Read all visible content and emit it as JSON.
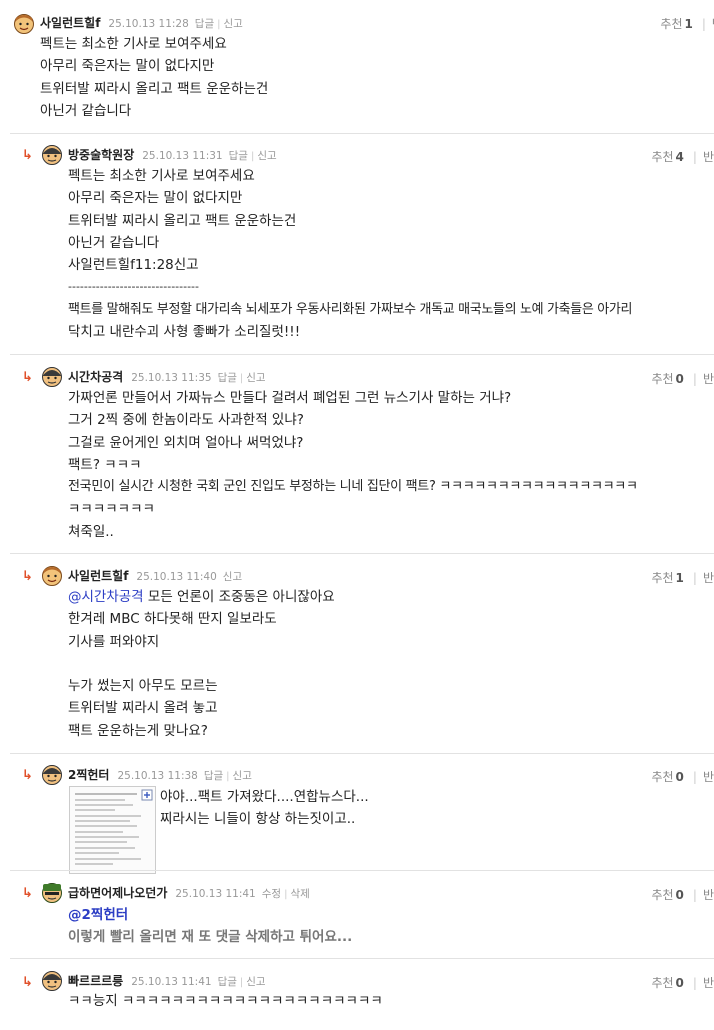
{
  "comments": [
    {
      "nick": "사일런트힐f",
      "date": "25.10.13 11:28",
      "actions": [
        "답글",
        "신고"
      ],
      "rec_label": "추천",
      "rec_count": "1",
      "opp_label": "반대",
      "lines": [
        "펙트는 최소한 기사로 보여주세요",
        "아무리 죽은자는 말이 없다지만",
        "트위터발 찌라시 올리고 팩트 운운하는건",
        "아닌거 같습니다"
      ]
    },
    {
      "nick": "방중술학원장",
      "date": "25.10.13 11:31",
      "actions": [
        "답글",
        "신고"
      ],
      "rec_label": "추천",
      "rec_count": "4",
      "opp_label": "반",
      "lines": [
        "펙트는 최소한 기사로 보여주세요",
        "아무리 죽은자는 말이 없다지만",
        "트위터발 찌라시 올리고 팩트 운운하는건",
        "아닌거 같습니다",
        "사일런트힐f11:28신고",
        "---------------------------------",
        "팩트를 말해줘도 부정할 대가리속 뇌세포가 우동사리화된 가짜보수 개독교 매국노들의 노예 가축들은 아가리",
        "닥치고 내란수괴 사형 좋빠가 소리질럿!!!"
      ]
    },
    {
      "nick": "시간차공격",
      "date": "25.10.13 11:35",
      "actions": [
        "답글",
        "신고"
      ],
      "rec_label": "추천",
      "rec_count": "0",
      "opp_label": "반",
      "lines": [
        "가짜언론 만들어서 가짜뉴스 만들다 걸려서 폐업된 그런 뉴스기사 말하는 거냐?",
        "그거 2찍 중에 한놈이라도 사과한적 있냐?",
        "그걸로 윤어게인 외치며 얼아나 써먹었냐?",
        "팩트? ㅋㅋㅋ",
        "전국민이 실시간 시청한 국회 군인 진입도 부정하는 니네 집단이 팩트? ㅋㅋㅋㅋㅋㅋㅋㅋㅋㅋㅋㅋㅋㅋㅋㅋㅋ",
        "ㅋㅋㅋㅋㅋㅋㅋ",
        "쳐죽일.."
      ]
    },
    {
      "nick": "사일런트힐f",
      "date": "25.10.13 11:40",
      "actions": [
        "신고"
      ],
      "rec_label": "추천",
      "rec_count": "1",
      "opp_label": "반",
      "mention": "@시간차공격",
      "lines": [
        "모든 언론이 조중동은 아니잖아요",
        "한겨레 MBC 하다못해 딴지 일보라도",
        "기사를 퍼와야지",
        "",
        "누가 썼는지 아무도 모르는",
        "트위터발 찌라시 올려 놓고",
        "팩트 운운하는게 맞나요?"
      ]
    },
    {
      "nick": "2찍헌터",
      "date": "25.10.13 11:38",
      "actions": [
        "답글",
        "신고"
      ],
      "rec_label": "추천",
      "rec_count": "0",
      "opp_label": "반",
      "lines": [
        "야야...팩트 가져왔다....연합뉴스다...",
        "찌라시는 니들이 항상 하는짓이고.."
      ]
    },
    {
      "nick": "급하면어제나오던가",
      "date": "25.10.13 11:41",
      "actions": [
        "수정",
        "삭제"
      ],
      "rec_label": "추천",
      "rec_count": "0",
      "opp_label": "반",
      "mention": "@2찍헌터",
      "lines": [
        "이렇게 빨리 올리면 재 또 댓글 삭제하고 튀어요..."
      ]
    },
    {
      "nick": "빠르르르릉",
      "date": "25.10.13 11:41",
      "actions": [
        "답글",
        "신고"
      ],
      "rec_label": "추천",
      "rec_count": "0",
      "opp_label": "반",
      "lines": [
        "ㅋㅋ능지 ㅋㅋㅋㅋㅋㅋㅋㅋㅋㅋㅋㅋㅋㅋㅋㅋㅋㅋㅋㅋㅋ"
      ]
    }
  ]
}
